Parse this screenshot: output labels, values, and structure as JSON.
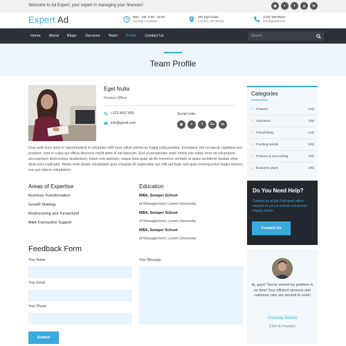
{
  "topbar": {
    "welcome": "Welcome to Ad Expert, your expert in managing your finances!",
    "socials": [
      "rss-icon",
      "twitter-icon",
      "facebook-icon",
      "google-plus-icon",
      "linkedin-icon"
    ]
  },
  "header": {
    "logo_part1": "Expert",
    "logo_part2": "Ad",
    "hours_line1": "Mon - Sat: 8:00 - 16:00",
    "hours_line2": "Sunday CLOSED",
    "address_line1": "292 Eget Nulla",
    "address_line2": "London, OZ 30130",
    "phone_line1": "(123) 45678910",
    "phone_line2": "info@gmail.com"
  },
  "nav": {
    "items": [
      "Home",
      "About",
      "Blog+",
      "Services",
      "Team",
      "Profile",
      "Contact Us"
    ],
    "active": "Profile",
    "search_placeholder": "Search..."
  },
  "banner": {
    "title": "Team Profile"
  },
  "profile": {
    "name": "Eget Nulla",
    "role": "Finance Officer",
    "phone": "+123 4567 890",
    "email": "info@gmail.com",
    "social_label": "Social Links",
    "bio": "Duis aute irure dolor in reprehenderit in voluptate velit esse cillum dolore eu fugiat nulla pariatur. Excepteur sint occaecat cupidatat non proident, sunt in culpa qui officia deserunt mollit anim id est laborum. Sed ut perspiciatis unde omnis iste natus error sit voluptatem accusantium doloremque laudantium, totam rem aperiam, eaque ipsa quae ab illo inventore veritatis et quasi architecto beatae vitae dicta sunt explicabo. Nemo enim ipsam voluptatem quia voluptas sit aspernatur aut odit aut fugit, sed quia consequuntur magni dolores eos qui ratione voluptatem."
  },
  "expertise": {
    "title": "Areas of Expertise",
    "items": [
      "Business Transformation",
      "Growth Strategy",
      "Restructuring and Turnaround",
      "M&A Transaction Support"
    ]
  },
  "education": {
    "title": "Education",
    "items": [
      {
        "degree": "MBA, Semper School",
        "detail": "of Management, Lorem University"
      },
      {
        "degree": "MBA, Semper School",
        "detail": "of Management, Lorem University"
      },
      {
        "degree": "MBA, Semper School",
        "detail": "of Management, Lorem University"
      }
    ]
  },
  "feedback": {
    "title": "Feedback Form",
    "name_label": "Your Name",
    "email_label": "Your Email",
    "phone_label": "Your Phone",
    "message_label": "Your Message",
    "submit_label": "Submit"
  },
  "categories": {
    "title": "Categories",
    "items": [
      {
        "label": "Finance",
        "count": "(19)"
      },
      {
        "label": "Insurance",
        "count": "(09)"
      },
      {
        "label": "Franchising",
        "count": "(19)"
      },
      {
        "label": "Funding trends",
        "count": "(08)"
      },
      {
        "label": "Finance & accounting",
        "count": "(08)"
      },
      {
        "label": "Business plans",
        "count": "(08)"
      }
    ]
  },
  "help": {
    "title": "Do You Need Help?",
    "text": "Contact us at the FinExpert office nearest to you or submit a business inquiry online.",
    "button": "Contact Us"
  },
  "testimonial": {
    "quote": "Hi, guys! You've solved my problem in no time! Your efficient services and customer care are second to none!",
    "name": "Conubia Nostra",
    "role": "(CEO & Founder)"
  },
  "colors": {
    "accent": "#3aa9dc",
    "dark": "#2b2f38",
    "light_bg": "#eef6fb"
  }
}
